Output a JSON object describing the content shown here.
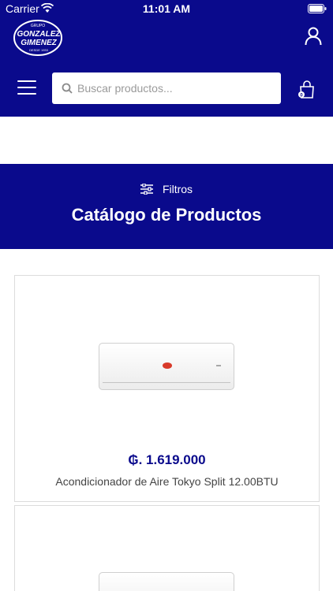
{
  "status_bar": {
    "carrier": "Carrier",
    "time": "11:01 AM"
  },
  "header": {
    "logo": {
      "brand_top": "GRUPO",
      "brand_line1": "GONZALEZ",
      "brand_line2": "GIMENEZ",
      "tagline": "DESDE 1933"
    },
    "search": {
      "placeholder": "Buscar productos..."
    },
    "cart": {
      "count": "0"
    },
    "icons": {
      "menu": "menu-icon",
      "user": "user-icon",
      "cart": "cart-icon",
      "search": "search-icon"
    }
  },
  "catalog": {
    "filters_label": "Filtros",
    "title": "Catálogo de Productos"
  },
  "products": [
    {
      "price": "₲. 1.619.000",
      "name": "Acondicionador de Aire Tokyo Split 12.00BTU"
    }
  ],
  "colors": {
    "brand_blue": "#0a0a8c",
    "accent_red": "#d83a2a"
  }
}
